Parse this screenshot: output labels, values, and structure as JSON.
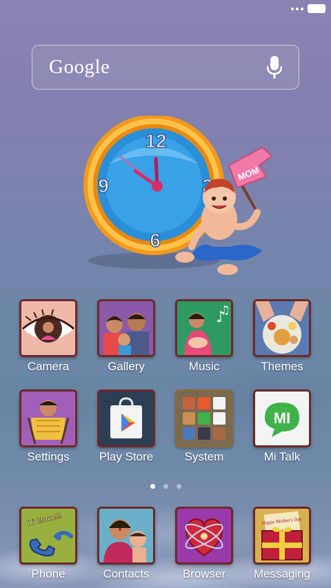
{
  "search": {
    "logo_text": "Google",
    "mic_icon": "microphone-icon"
  },
  "clock_widget": {
    "numerals": [
      "12",
      "3",
      "6",
      "9"
    ],
    "flag_text": "MOM"
  },
  "apps_row1": [
    {
      "label": "Camera",
      "icon": "camera-eye-icon"
    },
    {
      "label": "Gallery",
      "icon": "family-portrait-icon"
    },
    {
      "label": "Music",
      "icon": "mother-baby-music-icon"
    },
    {
      "label": "Themes",
      "icon": "food-plate-icon"
    }
  ],
  "apps_row2": [
    {
      "label": "Settings",
      "icon": "baby-carrier-icon"
    },
    {
      "label": "Play Store",
      "icon": "play-store-icon"
    },
    {
      "label": "System",
      "icon": "system-folder-icon"
    },
    {
      "label": "Mi Talk",
      "icon": "mi-talk-icon"
    }
  ],
  "dock": [
    {
      "label": "Phone",
      "icon": "phone-icon",
      "badge_text": "Hi Mom!!!"
    },
    {
      "label": "Contacts",
      "icon": "mother-child-icon"
    },
    {
      "label": "Browser",
      "icon": "browser-heart-icon"
    },
    {
      "label": "Messaging",
      "icon": "gift-card-icon",
      "card_text": "Happy Mother's Day"
    }
  ],
  "pager": {
    "pages": 3,
    "active": 1
  },
  "colors": {
    "mi_green": "#3fb24a",
    "clock_orange": "#f39a1b",
    "clock_blue": "#2a8fd8"
  }
}
